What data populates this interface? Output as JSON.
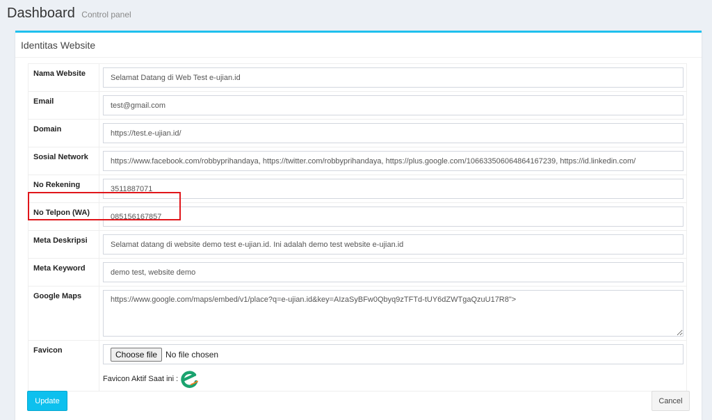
{
  "header": {
    "title": "Dashboard",
    "subtitle": "Control panel"
  },
  "box": {
    "title": "Identitas Website"
  },
  "fields": {
    "nama_website": {
      "label": "Nama Website",
      "value": "Selamat Datang di Web Test e-ujian.id"
    },
    "email": {
      "label": "Email",
      "value": "test@gmail.com"
    },
    "domain": {
      "label": "Domain",
      "value": "https://test.e-ujian.id/"
    },
    "sosial_network": {
      "label": "Sosial Network",
      "value": "https://www.facebook.com/robbyprihandaya, https://twitter.com/robbyprihandaya, https://plus.google.com/106633506064864167239, https://id.linkedin.com/"
    },
    "no_rekening": {
      "label": "No Rekening",
      "value": "3511887071"
    },
    "no_telpon": {
      "label": "No Telpon (WA)",
      "value": "085156167857"
    },
    "meta_deskripsi": {
      "label": "Meta Deskripsi",
      "value": "Selamat datang di website demo test e-ujian.id. Ini adalah demo test website e-ujian.id"
    },
    "meta_keyword": {
      "label": "Meta Keyword",
      "value": "demo test, website demo"
    },
    "google_maps": {
      "label": "Google Maps",
      "value": "https://www.google.com/maps/embed/v1/place?q=e-ujian.id&key=AIzaSyBFw0Qbyq9zTFTd-tUY6dZWTgaQzuU17R8\">"
    },
    "favicon": {
      "label": "Favicon",
      "button": "Choose file",
      "status": "No file chosen",
      "active_label": "Favicon Aktif Saat ini :",
      "icon": "e-ujian-logo-icon"
    }
  },
  "buttons": {
    "update": "Update",
    "cancel": "Cancel"
  },
  "colors": {
    "accent": "#1ec0ee",
    "highlight": "#e0151a",
    "logo_green": "#1aa36f",
    "logo_orange": "#f47b20"
  }
}
